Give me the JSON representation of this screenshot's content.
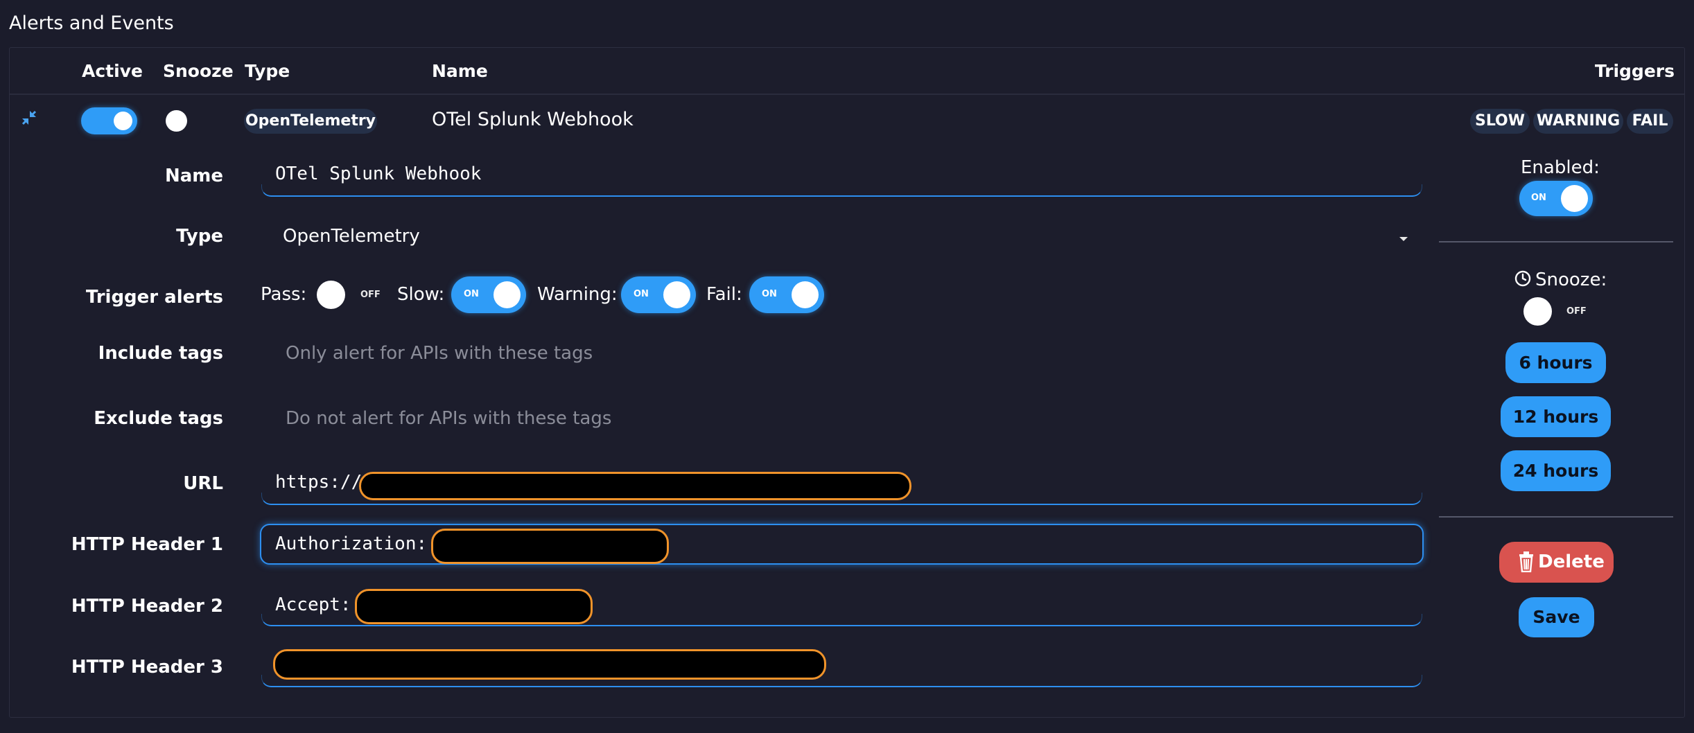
{
  "page": {
    "title": "Alerts and Events"
  },
  "table": {
    "headers": {
      "active": "Active",
      "snooze": "Snooze",
      "type": "Type",
      "name": "Name",
      "triggers": "Triggers"
    },
    "row": {
      "type_badge": "OpenTelemetry",
      "name": "OTel Splunk Webhook",
      "triggers": [
        "SLOW",
        "WARNING",
        "FAIL"
      ],
      "active": true,
      "snoozed": false
    }
  },
  "form": {
    "name_label": "Name",
    "name_value": "OTel Splunk Webhook",
    "type_label": "Type",
    "type_value": "OpenTelemetry",
    "trigger_label": "Trigger alerts",
    "triggers": {
      "pass_label": "Pass:",
      "pass_state": "OFF",
      "slow_label": "Slow:",
      "slow_state": "ON",
      "warning_label": "Warning:",
      "warning_state": "ON",
      "fail_label": "Fail:",
      "fail_state": "ON"
    },
    "include_label": "Include tags",
    "include_placeholder": "Only alert for APIs with these tags",
    "exclude_label": "Exclude tags",
    "exclude_placeholder": "Do not alert for APIs with these tags",
    "url_label": "URL",
    "url_prefix": "https://",
    "header1_label": "HTTP Header 1",
    "header1_prefix": "Authorization:",
    "header2_label": "HTTP Header 2",
    "header2_prefix": "Accept:",
    "header3_label": "HTTP Header 3"
  },
  "side": {
    "enabled_label": "Enabled:",
    "enabled_state": "ON",
    "snooze_label": "Snooze:",
    "snooze_state": "OFF",
    "snooze_6": "6 hours",
    "snooze_12": "12 hours",
    "snooze_24": "24 hours",
    "delete_label": "Delete",
    "save_label": "Save"
  },
  "colors": {
    "accent": "#2f9cf7",
    "background": "#1b1c2b",
    "delete": "#d9534f",
    "redaction_border": "#f0932a"
  },
  "icons": [
    "collapse-icon",
    "clock-icon",
    "trash-icon",
    "caret-down-icon"
  ]
}
